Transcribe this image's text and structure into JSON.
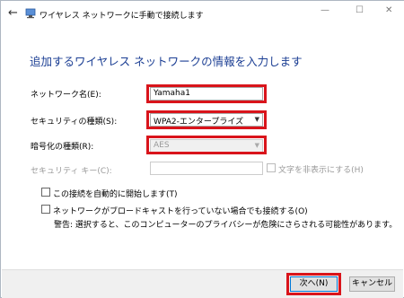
{
  "window": {
    "title": "ワイヤレス ネットワークに手動で接続します",
    "back_icon": "←",
    "minimize_icon": "—",
    "maximize_icon": "☐",
    "close_icon": "✕"
  },
  "heading": "追加するワイヤレス ネットワークの情報を入力します",
  "form": {
    "network_name": {
      "label": "ネットワーク名(E):",
      "value": "Yamaha1"
    },
    "security_type": {
      "label": "セキュリティの種類(S):",
      "value": "WPA2-エンタープライズ"
    },
    "encryption_type": {
      "label": "暗号化の種類(R):",
      "value": "AES"
    },
    "security_key": {
      "label": "セキュリティ キー(C):",
      "value": ""
    },
    "hide_chars_label": "文字を非表示にする(H)",
    "auto_start_label": "この接続を自動的に開始します(T)",
    "connect_hidden_label": "ネットワークがブロードキャストを行っていない場合でも接続する(O)",
    "warning": "警告: 選択すると、このコンピューターのプライバシーが危険にさらされる可能性があります。"
  },
  "buttons": {
    "next": "次へ(N)",
    "cancel": "キャンセル"
  },
  "colors": {
    "highlight": "#d9141b",
    "heading": "#1c3f94"
  }
}
